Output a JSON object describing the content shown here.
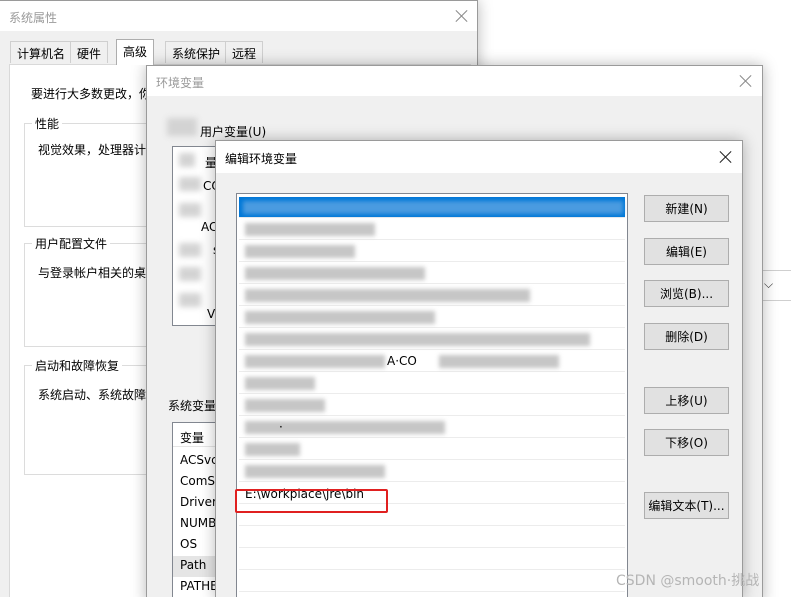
{
  "system_properties": {
    "title": "系统属性",
    "tabs": [
      "计算机名",
      "硬件",
      "高级",
      "系统保护",
      "远程"
    ],
    "selected_tab": "高级",
    "admin_note": "要进行大多数更改，你",
    "performance": {
      "label": "性能",
      "desc": "视觉效果，处理器计"
    },
    "user_profiles": {
      "label": "用户配置文件",
      "desc": "与登录帐户相关的桌"
    },
    "startup_recovery": {
      "label": "启动和故障恢复",
      "desc": "系统启动、系统故障"
    }
  },
  "env_vars": {
    "title": "环境变量",
    "user_vars_label": "用户变量(U)",
    "user_var_fragments": [
      "量",
      "CO",
      "AC",
      "s",
      "V"
    ],
    "system_vars_label": "系统变量",
    "system_vars_column": "变量",
    "system_vars": [
      "ACSvc",
      "ComSp",
      "Driver",
      "NUMB",
      "OS",
      "Path",
      "PATHE"
    ]
  },
  "edit_env": {
    "title": "编辑环境变量",
    "list_fragments": [
      "A·CO",
      "·"
    ],
    "new_entry": "E:\\workplace\\jre\\bin",
    "buttons": {
      "new": "新建(N)",
      "edit": "编辑(E)",
      "browse": "浏览(B)...",
      "delete": "删除(D)",
      "move_up": "上移(U)",
      "move_down": "下移(O)",
      "edit_text": "编辑文本(T)..."
    }
  },
  "watermark": "CSDN @smooth·挑战"
}
